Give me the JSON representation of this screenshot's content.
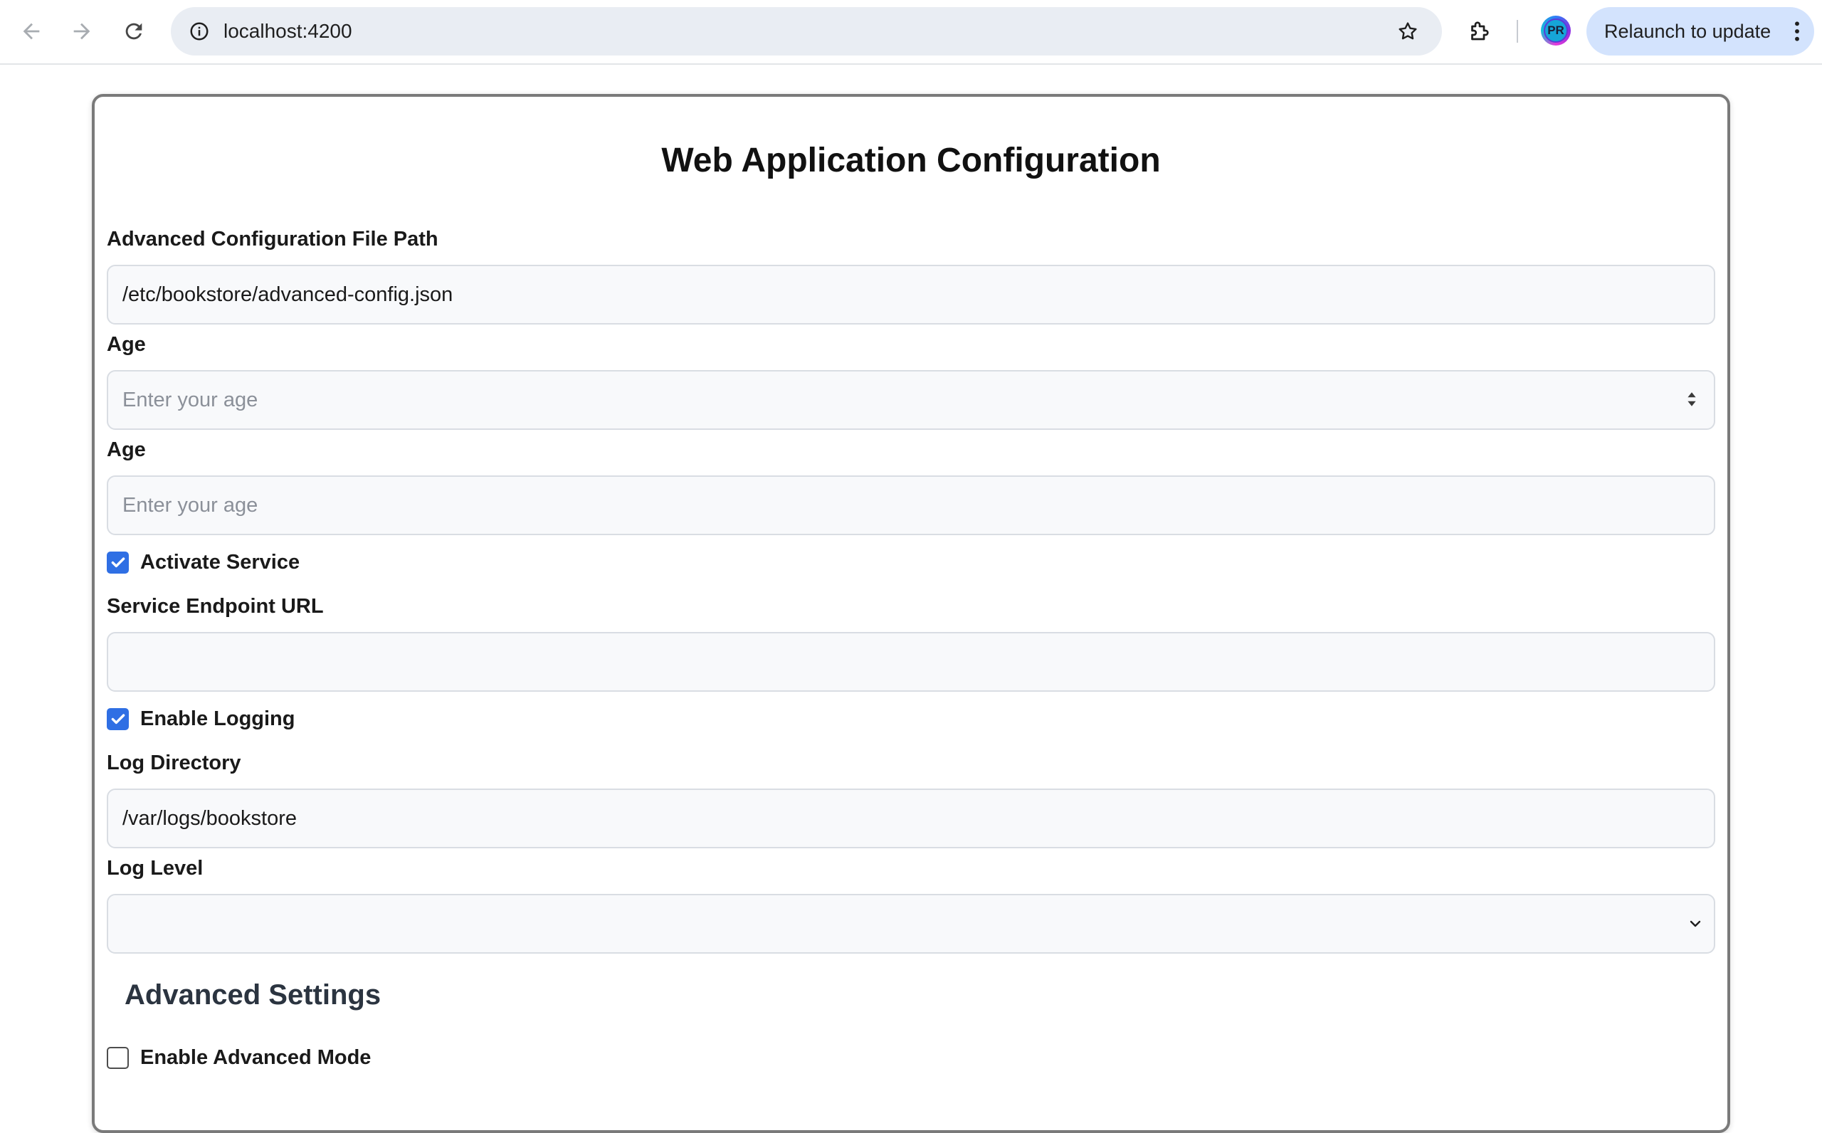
{
  "browser": {
    "url": "localhost:4200",
    "relaunch_label": "Relaunch to update",
    "avatar_initials": "PR"
  },
  "page": {
    "title": "Web Application Configuration"
  },
  "form": {
    "config_path": {
      "label": "Advanced Configuration File Path",
      "value": "/etc/bookstore/advanced-config.json"
    },
    "age_number": {
      "label": "Age",
      "placeholder": "Enter your age"
    },
    "age_text": {
      "label": "Age",
      "placeholder": "Enter your age"
    },
    "activate_service": {
      "label": "Activate Service",
      "checked": true
    },
    "service_endpoint": {
      "label": "Service Endpoint URL",
      "value": ""
    },
    "enable_logging": {
      "label": "Enable Logging",
      "checked": true
    },
    "log_directory": {
      "label": "Log Directory",
      "value": "/var/logs/bookstore"
    },
    "log_level": {
      "label": "Log Level",
      "selected": ""
    },
    "advanced": {
      "title": "Advanced Settings",
      "enable_advanced_mode": {
        "label": "Enable Advanced Mode",
        "checked": false
      }
    }
  },
  "colors": {
    "accent": "#2f6fe4",
    "relaunch_bg": "#d3e3fd",
    "omnibox_bg": "#e9edf3"
  }
}
